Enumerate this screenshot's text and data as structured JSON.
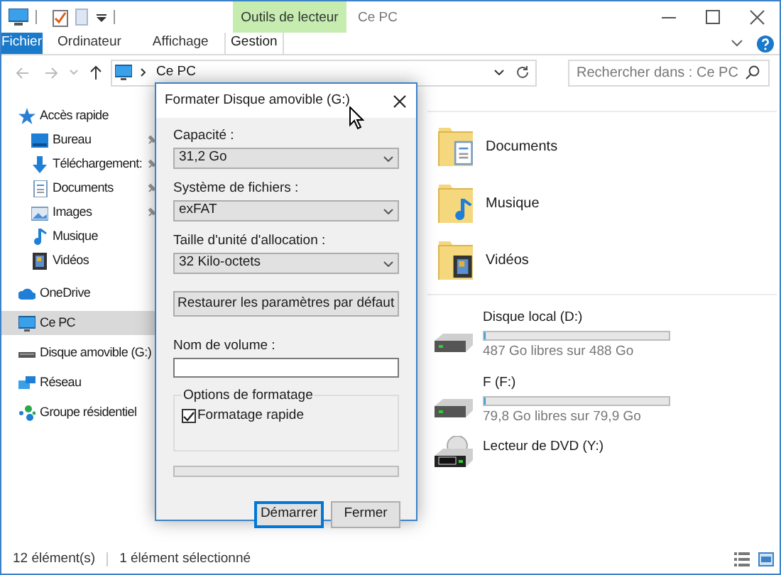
{
  "window": {
    "title": "Ce PC",
    "context_tab": "Outils de lecteur"
  },
  "ribbon_tabs": [
    {
      "label": "Fichier",
      "kind": "file",
      "selected": false
    },
    {
      "label": "Ordinateur",
      "kind": "tab",
      "selected": false
    },
    {
      "label": "Affichage",
      "kind": "tab",
      "selected": false
    },
    {
      "label": "Gestion",
      "kind": "context",
      "selected": false
    }
  ],
  "address": {
    "path": "Ce PC"
  },
  "search": {
    "placeholder": "Rechercher dans : Ce PC"
  },
  "sidebar": {
    "items": [
      {
        "label": "Accès rapide",
        "selected": false,
        "children": [
          {
            "label": "Bureau",
            "pinned": true,
            "selected": false
          },
          {
            "label": "Téléchargement:",
            "pinned": true,
            "selected": false
          },
          {
            "label": "Documents",
            "pinned": true,
            "selected": false
          },
          {
            "label": "Images",
            "pinned": true,
            "selected": false
          },
          {
            "label": "Musique",
            "pinned": false,
            "selected": false
          },
          {
            "label": "Vidéos",
            "pinned": false,
            "selected": false
          }
        ]
      },
      {
        "label": "OneDrive",
        "selected": false
      },
      {
        "label": "Ce PC",
        "selected": true
      },
      {
        "label": "Disque amovible (G:)",
        "selected": false
      },
      {
        "label": "Réseau",
        "selected": false
      },
      {
        "label": "Groupe résidentiel",
        "selected": false
      }
    ]
  },
  "folders": [
    {
      "label": "Documents"
    },
    {
      "label": "Musique"
    },
    {
      "label": "Vidéos"
    }
  ],
  "drives": [
    {
      "label": "Disque local (D:)",
      "kind": "hdd",
      "level": 0.01,
      "space": "487 Go libres sur 488 Go"
    },
    {
      "label": "F (F:)",
      "kind": "hdd",
      "level": 0.01,
      "space": "79,8 Go libres sur 79,9 Go"
    },
    {
      "label": "Lecteur de DVD (Y:)",
      "kind": "dvd"
    }
  ],
  "status_bar": {
    "count": "12 élément(s)",
    "selection": "1 élément sélectionné"
  },
  "dialog": {
    "title": "Formater Disque amovible (G:)",
    "fields": [
      {
        "label": "Capacité :",
        "value": "31,2 Go"
      },
      {
        "label": "Système de fichiers :",
        "value": "exFAT"
      },
      {
        "label": "Taille d'unité d'allocation :",
        "value": "32 Kilo-octets"
      }
    ],
    "restore_button": "Restaurer les paramètres par défaut",
    "volume_label": "Nom de volume :",
    "options_title": "Options de formatage",
    "quick_format": {
      "label": "Formatage rapide",
      "checked": true
    },
    "progress": {
      "level": 0
    },
    "buttons": [
      {
        "label": "Démarrer",
        "focused": true
      },
      {
        "label": "Fermer",
        "focused": false
      }
    ]
  }
}
